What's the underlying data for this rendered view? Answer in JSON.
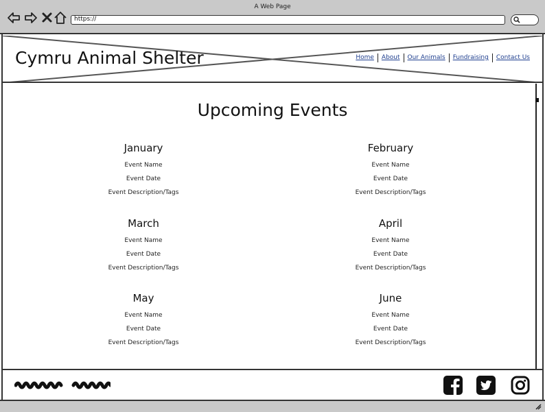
{
  "browser": {
    "window_title": "A Web Page",
    "url": "https://"
  },
  "header": {
    "site_title": "Cymru Animal Shelter",
    "nav": [
      {
        "label": "Home"
      },
      {
        "label": "About"
      },
      {
        "label": "Our Animals"
      },
      {
        "label": "Fundraising"
      },
      {
        "label": "Contact Us"
      }
    ]
  },
  "main": {
    "title": "Upcoming Events",
    "months": [
      {
        "name": "January",
        "event_name": "Event Name",
        "event_date": "Event Date",
        "event_desc": "Event Description/Tags"
      },
      {
        "name": "February",
        "event_name": "Event Name",
        "event_date": "Event Date",
        "event_desc": "Event Description/Tags"
      },
      {
        "name": "March",
        "event_name": "Event Name",
        "event_date": "Event Date",
        "event_desc": "Event Description/Tags"
      },
      {
        "name": "April",
        "event_name": "Event Name",
        "event_date": "Event Date",
        "event_desc": "Event Description/Tags"
      },
      {
        "name": "May",
        "event_name": "Event Name",
        "event_date": "Event Date",
        "event_desc": "Event Description/Tags"
      },
      {
        "name": "June",
        "event_name": "Event Name",
        "event_date": "Event Date",
        "event_desc": "Event Description/Tags"
      }
    ]
  },
  "footer": {
    "social": [
      "facebook-icon",
      "twitter-icon",
      "instagram-icon"
    ]
  },
  "colors": {
    "chrome": "#c9c9c9",
    "link": "#1f3f8f",
    "ink": "#111111"
  }
}
